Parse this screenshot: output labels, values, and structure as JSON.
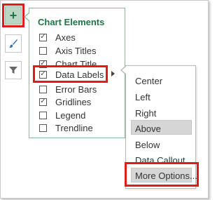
{
  "side_buttons": {
    "plus_glyph": "+",
    "plus_icon": "chart-elements-plus-icon",
    "brush_icon": "chart-styles-brush-icon",
    "filter_icon": "chart-filters-icon"
  },
  "panel": {
    "title": "Chart Elements",
    "items": [
      {
        "label": "Axes",
        "checked": true
      },
      {
        "label": "Axis Titles",
        "checked": false
      },
      {
        "label": "Chart Title",
        "checked": true
      },
      {
        "label": "Data Labels",
        "checked": true
      },
      {
        "label": "Error Bars",
        "checked": false
      },
      {
        "label": "Gridlines",
        "checked": true
      },
      {
        "label": "Legend",
        "checked": false
      },
      {
        "label": "Trendline",
        "checked": false
      }
    ]
  },
  "submenu": {
    "items": [
      "Center",
      "Left",
      "Right",
      "Above",
      "Below",
      "Data Callout",
      "More Options..."
    ],
    "selected": "Above",
    "hovered": "More Options..."
  },
  "colors": {
    "accent_green": "#217346",
    "highlight_red": "#e11a1a",
    "selected_bg": "#d6d6d6"
  }
}
